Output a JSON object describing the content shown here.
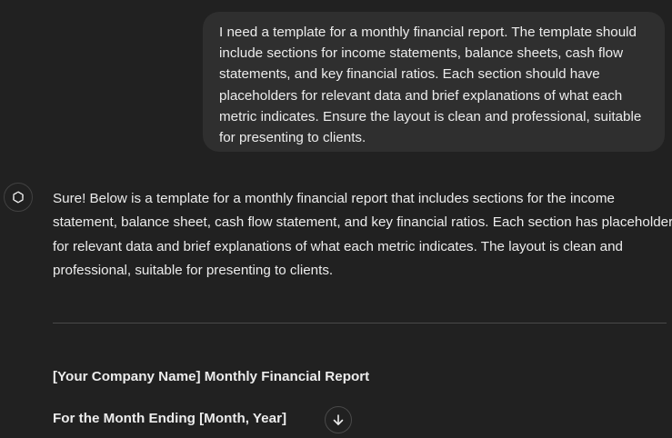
{
  "user_message": {
    "lines": [
      "I need a template for a monthly financial report. The template should",
      "include sections for income statements, balance sheets, cash flow",
      "statements, and key financial ratios. Each section should have",
      "placeholders for relevant data and brief explanations of what each",
      "metric indicates. Ensure the layout is clean and professional, suitable",
      "for presenting to clients."
    ]
  },
  "assistant_message": {
    "avatar_icon": "openai-logo-icon",
    "lines": [
      "Sure! Below is a template for a monthly financial report that includes sections for the income",
      "statement, balance sheet, cash flow statement, and key financial ratios. Each section has placeholders",
      "for relevant data and brief explanations of what each metric indicates. The layout is clean and",
      "professional, suitable for presenting to clients."
    ],
    "report_title": "[Your Company Name] Monthly Financial Report",
    "report_subtitle": "For the Month Ending [Month, Year]"
  },
  "scroll_button": {
    "icon": "arrow-down-icon"
  },
  "colors": {
    "background": "#212121",
    "bubble": "#2f2f2f",
    "text": "#ececec",
    "divider": "#4a4a4a"
  }
}
